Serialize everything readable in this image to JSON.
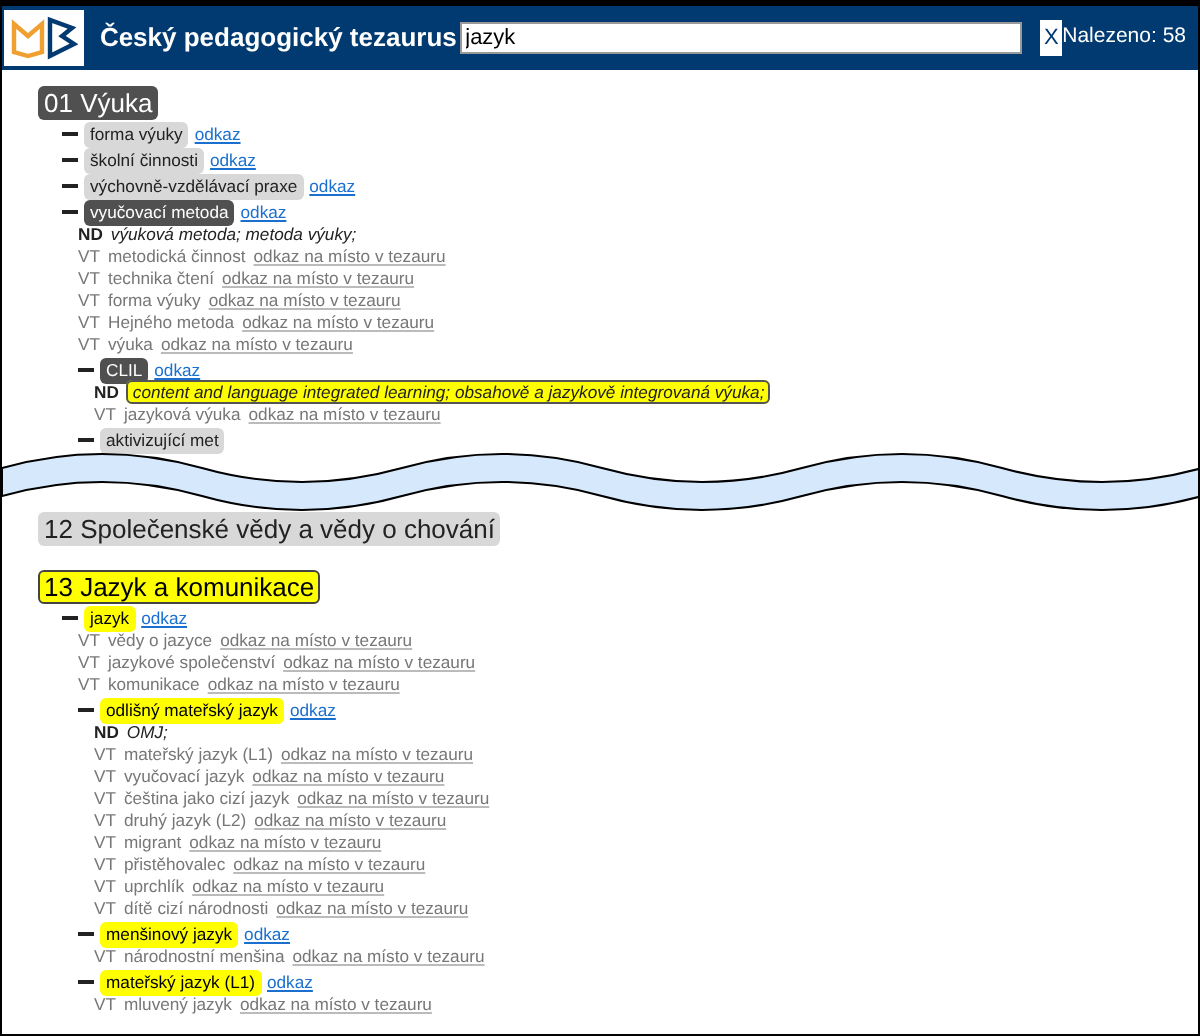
{
  "header": {
    "title": "Český pedagogický tezaurus",
    "search": {
      "value": "jazyk"
    },
    "clear_button": "X",
    "found": "Nalezeno: 58"
  },
  "sections_before_break": [
    {
      "heading": "01 Výuka",
      "expanded": true,
      "match": false,
      "terms": [
        {
          "label": "forma výuky",
          "expanded": false,
          "match": false,
          "link": "odkaz"
        },
        {
          "label": "školní činnosti",
          "expanded": false,
          "match": false,
          "link": "odkaz"
        },
        {
          "label": "výchovně-vzdělávací praxe",
          "expanded": false,
          "match": false,
          "link": "odkaz"
        },
        {
          "label": "vyučovací metoda",
          "expanded": true,
          "match": false,
          "link": "odkaz",
          "nd_label": "ND",
          "nd": {
            "text": "výuková metoda; metoda výuky;",
            "match": false
          },
          "vt": [
            {
              "tag": "VT",
              "label": "metodická činnost",
              "link": "odkaz na místo v tezauru"
            },
            {
              "tag": "VT",
              "label": "technika čtení",
              "link": "odkaz na místo v tezauru"
            },
            {
              "tag": "VT",
              "label": "forma výuky",
              "link": "odkaz na místo v tezauru"
            },
            {
              "tag": "VT",
              "label": "Hejného metoda",
              "link": "odkaz na místo v tezauru"
            },
            {
              "tag": "VT",
              "label": "výuka",
              "link": "odkaz na místo v tezauru"
            }
          ],
          "children": [
            {
              "label": "CLIL",
              "expanded": true,
              "match": false,
              "link": "odkaz",
              "nd_label": "ND",
              "nd": {
                "text": "content and language integrated learning; obsahově a jazykově integrovaná výuka;",
                "match": true
              },
              "vt": [
                {
                  "tag": "VT",
                  "label": "jazyková výuka",
                  "link": "odkaz na místo v tezauru"
                }
              ]
            },
            {
              "label": "aktivizující met",
              "expanded": false,
              "match": false
            }
          ]
        }
      ]
    }
  ],
  "sections_after_break": [
    {
      "heading": "12 Společenské vědy a vědy o chování",
      "expanded": false,
      "match": false
    },
    {
      "heading": "13 Jazyk a komunikace",
      "match": true,
      "terms": [
        {
          "label": "jazyk",
          "match": true,
          "link": "odkaz",
          "vt": [
            {
              "tag": "VT",
              "label": "vědy o jazyce",
              "link": "odkaz na místo v tezauru"
            },
            {
              "tag": "VT",
              "label": "jazykové společenství",
              "link": "odkaz na místo v tezauru"
            },
            {
              "tag": "VT",
              "label": "komunikace",
              "link": "odkaz na místo v tezauru"
            }
          ],
          "children": [
            {
              "label": "odlišný mateřský jazyk",
              "match": true,
              "link": "odkaz",
              "nd_label": "ND",
              "nd": {
                "text": "OMJ;",
                "match": false
              },
              "vt": [
                {
                  "tag": "VT",
                  "label": "mateřský jazyk (L1)",
                  "link": "odkaz na místo v tezauru"
                },
                {
                  "tag": "VT",
                  "label": "vyučovací jazyk",
                  "link": "odkaz na místo v tezauru"
                },
                {
                  "tag": "VT",
                  "label": "čeština jako cizí jazyk",
                  "link": "odkaz na místo v tezauru"
                },
                {
                  "tag": "VT",
                  "label": "druhý jazyk (L2)",
                  "link": "odkaz na místo v tezauru"
                },
                {
                  "tag": "VT",
                  "label": "migrant",
                  "link": "odkaz na místo v tezauru"
                },
                {
                  "tag": "VT",
                  "label": "přistěhovalec",
                  "link": "odkaz na místo v tezauru"
                },
                {
                  "tag": "VT",
                  "label": "uprchlík",
                  "link": "odkaz na místo v tezauru"
                },
                {
                  "tag": "VT",
                  "label": "dítě cizí národnosti",
                  "link": "odkaz na místo v tezauru"
                }
              ]
            },
            {
              "label": "menšinový jazyk",
              "match": true,
              "link": "odkaz",
              "vt": [
                {
                  "tag": "VT",
                  "label": "národnostní menšina",
                  "link": "odkaz na místo v tezauru"
                }
              ]
            },
            {
              "label": "mateřský jazyk (L1)",
              "match": true,
              "link": "odkaz",
              "vt": [
                {
                  "tag": "VT",
                  "label": "mluvený jazyk",
                  "link": "odkaz na místo v tezauru"
                }
              ]
            }
          ]
        }
      ]
    }
  ]
}
